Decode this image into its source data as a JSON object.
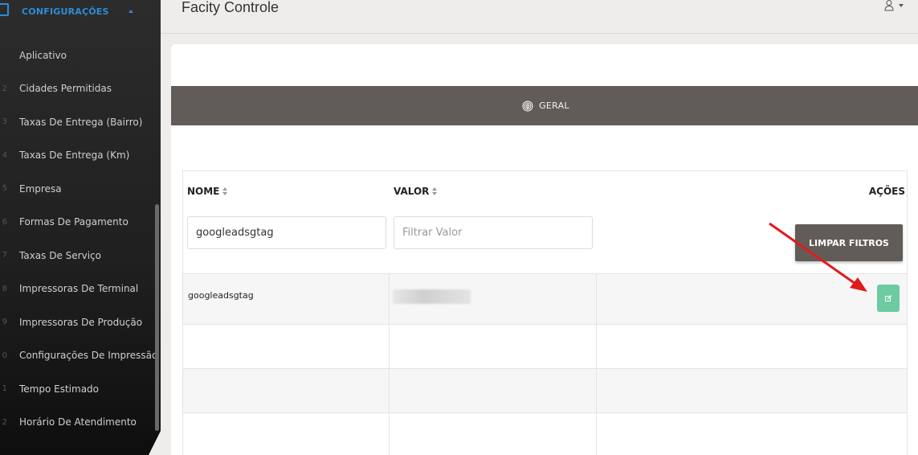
{
  "sidebar": {
    "section_label": "CONFIGURAÇÕES",
    "items": [
      {
        "num": "",
        "label": "Aplicativo"
      },
      {
        "num": "2",
        "label": "Cidades Permitidas"
      },
      {
        "num": "3",
        "label": "Taxas De Entrega (Bairro)"
      },
      {
        "num": "4",
        "label": "Taxas De Entrega (Km)"
      },
      {
        "num": "5",
        "label": "Empresa"
      },
      {
        "num": "6",
        "label": "Formas De Pagamento"
      },
      {
        "num": "7",
        "label": "Taxas De Serviço"
      },
      {
        "num": "8",
        "label": "Impressoras De Terminal"
      },
      {
        "num": "9",
        "label": "Impressoras De Produção"
      },
      {
        "num": "0",
        "label": "Configurações De Impressão"
      },
      {
        "num": "1",
        "label": "Tempo Estimado"
      },
      {
        "num": "2",
        "label": "Horário De Atendimento"
      }
    ]
  },
  "header": {
    "title": "Facity Controle"
  },
  "tab": {
    "label": "GERAL"
  },
  "table": {
    "columns": {
      "name": "NOME",
      "value": "VALOR",
      "actions": "AÇÕES"
    },
    "filters": {
      "name_value": "googleadsgtag",
      "value_placeholder": "Filtrar Valor"
    },
    "clear_button": "LIMPAR FILTROS",
    "rows": [
      {
        "name": "googleadsgtag"
      }
    ]
  },
  "colors": {
    "accent": "#2f8bd8",
    "bar": "#625c58",
    "edit": "#6ccb9f",
    "annotation_arrow": "#e01b1b"
  },
  "icons": {
    "section": "config-icon",
    "user": "user-icon",
    "tab": "fingerprint-icon",
    "edit": "edit-icon"
  }
}
